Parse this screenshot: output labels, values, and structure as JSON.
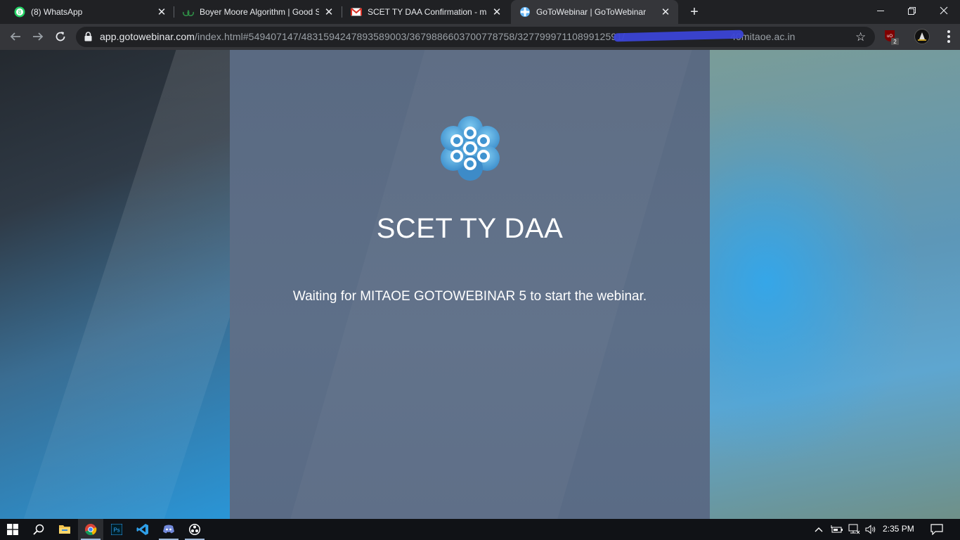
{
  "tabs": [
    {
      "title": "(8) WhatsApp",
      "icon": "whatsapp-icon",
      "active": false
    },
    {
      "title": "Boyer Moore Algorithm | Good S",
      "icon": "geeksforgeeks-icon",
      "active": false
    },
    {
      "title": "SCET TY DAA Confirmation - mai",
      "icon": "gmail-icon",
      "active": false
    },
    {
      "title": "GoToWebinar | GoToWebinar",
      "icon": "gotowebinar-icon",
      "active": true
    }
  ],
  "whatsapp_badge": "8",
  "address_bar": {
    "host": "app.gotowebinar.com",
    "path": "/index.html#549407147/4831594247893589003/3679886603700778758/3277999711089912591/",
    "suffix": "40mitaoe.ac.in"
  },
  "extensions": {
    "ublock_badge": "2"
  },
  "webinar": {
    "title": "SCET TY DAA",
    "waiting_message": "Waiting for MITAOE GOTOWEBINAR 5 to start the webinar."
  },
  "taskbar": {
    "apps": [
      "start-icon",
      "search-icon",
      "file-explorer-icon",
      "chrome-icon",
      "photoshop-icon",
      "vscode-icon",
      "discord-icon",
      "obs-icon"
    ],
    "clock": "2:35 PM"
  },
  "colors": {
    "accent_blue": "#2a95d6",
    "panel": "#5a6a82",
    "chrome_dark": "#202124"
  }
}
